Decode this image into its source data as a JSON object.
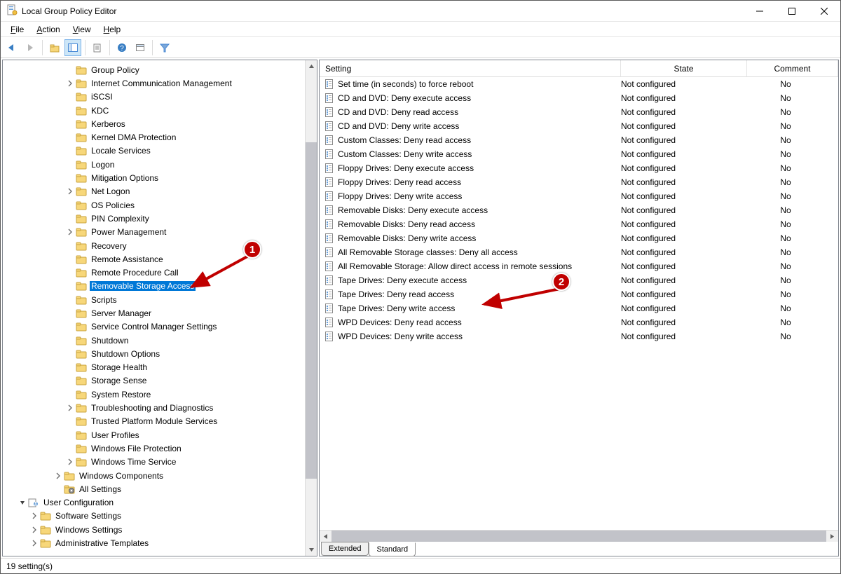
{
  "window": {
    "title": "Local Group Policy Editor"
  },
  "menubar": {
    "file": "File",
    "action": "Action",
    "view": "View",
    "help": "Help"
  },
  "tree": {
    "items": [
      {
        "indent": 5,
        "expander": "",
        "icon": "folder",
        "label": "Group Policy"
      },
      {
        "indent": 5,
        "expander": ">",
        "icon": "folder",
        "label": "Internet Communication Management"
      },
      {
        "indent": 5,
        "expander": "",
        "icon": "folder",
        "label": "iSCSI"
      },
      {
        "indent": 5,
        "expander": "",
        "icon": "folder",
        "label": "KDC"
      },
      {
        "indent": 5,
        "expander": "",
        "icon": "folder",
        "label": "Kerberos"
      },
      {
        "indent": 5,
        "expander": "",
        "icon": "folder",
        "label": "Kernel DMA Protection"
      },
      {
        "indent": 5,
        "expander": "",
        "icon": "folder",
        "label": "Locale Services"
      },
      {
        "indent": 5,
        "expander": "",
        "icon": "folder",
        "label": "Logon"
      },
      {
        "indent": 5,
        "expander": "",
        "icon": "folder",
        "label": "Mitigation Options"
      },
      {
        "indent": 5,
        "expander": ">",
        "icon": "folder",
        "label": "Net Logon"
      },
      {
        "indent": 5,
        "expander": "",
        "icon": "folder",
        "label": "OS Policies"
      },
      {
        "indent": 5,
        "expander": "",
        "icon": "folder",
        "label": "PIN Complexity"
      },
      {
        "indent": 5,
        "expander": ">",
        "icon": "folder",
        "label": "Power Management"
      },
      {
        "indent": 5,
        "expander": "",
        "icon": "folder",
        "label": "Recovery"
      },
      {
        "indent": 5,
        "expander": "",
        "icon": "folder",
        "label": "Remote Assistance"
      },
      {
        "indent": 5,
        "expander": "",
        "icon": "folder",
        "label": "Remote Procedure Call"
      },
      {
        "indent": 5,
        "expander": "",
        "icon": "folder",
        "label": "Removable Storage Access",
        "selected": true
      },
      {
        "indent": 5,
        "expander": "",
        "icon": "folder",
        "label": "Scripts"
      },
      {
        "indent": 5,
        "expander": "",
        "icon": "folder",
        "label": "Server Manager"
      },
      {
        "indent": 5,
        "expander": "",
        "icon": "folder",
        "label": "Service Control Manager Settings"
      },
      {
        "indent": 5,
        "expander": "",
        "icon": "folder",
        "label": "Shutdown"
      },
      {
        "indent": 5,
        "expander": "",
        "icon": "folder",
        "label": "Shutdown Options"
      },
      {
        "indent": 5,
        "expander": "",
        "icon": "folder",
        "label": "Storage Health"
      },
      {
        "indent": 5,
        "expander": "",
        "icon": "folder",
        "label": "Storage Sense"
      },
      {
        "indent": 5,
        "expander": "",
        "icon": "folder",
        "label": "System Restore"
      },
      {
        "indent": 5,
        "expander": ">",
        "icon": "folder",
        "label": "Troubleshooting and Diagnostics"
      },
      {
        "indent": 5,
        "expander": "",
        "icon": "folder",
        "label": "Trusted Platform Module Services"
      },
      {
        "indent": 5,
        "expander": "",
        "icon": "folder",
        "label": "User Profiles"
      },
      {
        "indent": 5,
        "expander": "",
        "icon": "folder",
        "label": "Windows File Protection"
      },
      {
        "indent": 5,
        "expander": ">",
        "icon": "folder",
        "label": "Windows Time Service"
      },
      {
        "indent": 4,
        "expander": ">",
        "icon": "folder",
        "label": "Windows Components"
      },
      {
        "indent": 4,
        "expander": "",
        "icon": "allsettings",
        "label": "All Settings"
      },
      {
        "indent": 1,
        "expander": "v",
        "icon": "userconfig",
        "label": "User Configuration"
      },
      {
        "indent": 2,
        "expander": ">",
        "icon": "folder",
        "label": "Software Settings"
      },
      {
        "indent": 2,
        "expander": ">",
        "icon": "folder",
        "label": "Windows Settings"
      },
      {
        "indent": 2,
        "expander": ">",
        "icon": "folder",
        "label": "Administrative Templates"
      }
    ]
  },
  "list": {
    "columns": {
      "setting": "Setting",
      "state": "State",
      "comment": "Comment"
    },
    "rows": [
      {
        "setting": "Set time (in seconds) to force reboot",
        "state": "Not configured",
        "comment": "No"
      },
      {
        "setting": "CD and DVD: Deny execute access",
        "state": "Not configured",
        "comment": "No"
      },
      {
        "setting": "CD and DVD: Deny read access",
        "state": "Not configured",
        "comment": "No"
      },
      {
        "setting": "CD and DVD: Deny write access",
        "state": "Not configured",
        "comment": "No"
      },
      {
        "setting": "Custom Classes: Deny read access",
        "state": "Not configured",
        "comment": "No"
      },
      {
        "setting": "Custom Classes: Deny write access",
        "state": "Not configured",
        "comment": "No"
      },
      {
        "setting": "Floppy Drives: Deny execute access",
        "state": "Not configured",
        "comment": "No"
      },
      {
        "setting": "Floppy Drives: Deny read access",
        "state": "Not configured",
        "comment": "No"
      },
      {
        "setting": "Floppy Drives: Deny write access",
        "state": "Not configured",
        "comment": "No"
      },
      {
        "setting": "Removable Disks: Deny execute access",
        "state": "Not configured",
        "comment": "No"
      },
      {
        "setting": "Removable Disks: Deny read access",
        "state": "Not configured",
        "comment": "No"
      },
      {
        "setting": "Removable Disks: Deny write access",
        "state": "Not configured",
        "comment": "No"
      },
      {
        "setting": "All Removable Storage classes: Deny all access",
        "state": "Not configured",
        "comment": "No"
      },
      {
        "setting": "All Removable Storage: Allow direct access in remote sessions",
        "state": "Not configured",
        "comment": "No"
      },
      {
        "setting": "Tape Drives: Deny execute access",
        "state": "Not configured",
        "comment": "No"
      },
      {
        "setting": "Tape Drives: Deny read access",
        "state": "Not configured",
        "comment": "No"
      },
      {
        "setting": "Tape Drives: Deny write access",
        "state": "Not configured",
        "comment": "No"
      },
      {
        "setting": "WPD Devices: Deny read access",
        "state": "Not configured",
        "comment": "No"
      },
      {
        "setting": "WPD Devices: Deny write access",
        "state": "Not configured",
        "comment": "No"
      }
    ],
    "tabs": {
      "extended": "Extended",
      "standard": "Standard"
    }
  },
  "statusbar": {
    "text": "19 setting(s)"
  },
  "annotations": {
    "one": "1",
    "two": "2"
  }
}
